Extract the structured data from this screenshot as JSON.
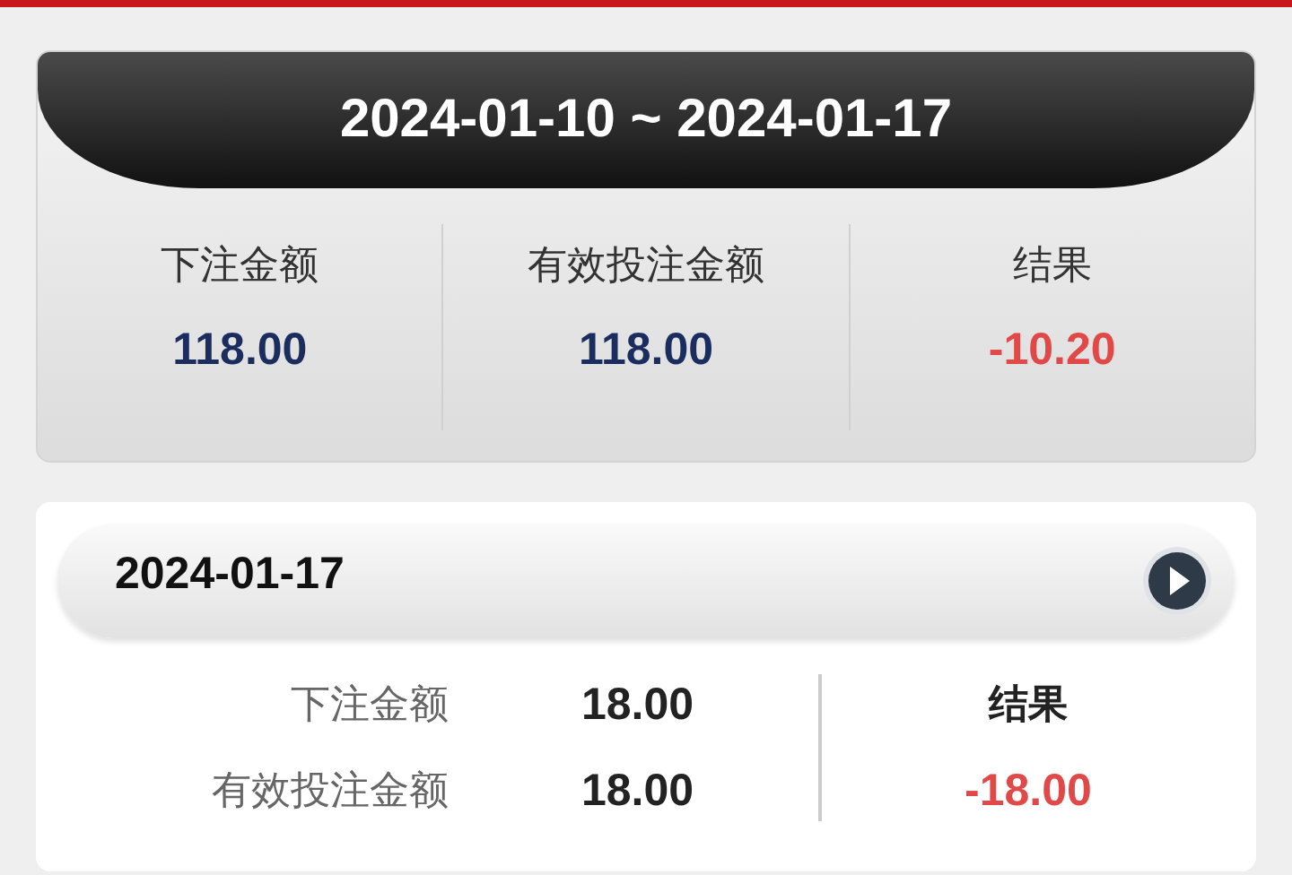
{
  "summary": {
    "date_range": "2024-01-10 ~ 2024-01-17",
    "stats": [
      {
        "label": "下注金额",
        "value": "118.00",
        "kind": "amount"
      },
      {
        "label": "有效投注金额",
        "value": "118.00",
        "kind": "amount"
      },
      {
        "label": "结果",
        "value": "-10.20",
        "kind": "result"
      }
    ]
  },
  "days": [
    {
      "date": "2024-01-17",
      "rows": [
        {
          "label": "下注金额",
          "value": "18.00"
        },
        {
          "label": "有效投注金额",
          "value": "18.00"
        }
      ],
      "result_label": "结果",
      "result": "-18.00"
    }
  ]
}
